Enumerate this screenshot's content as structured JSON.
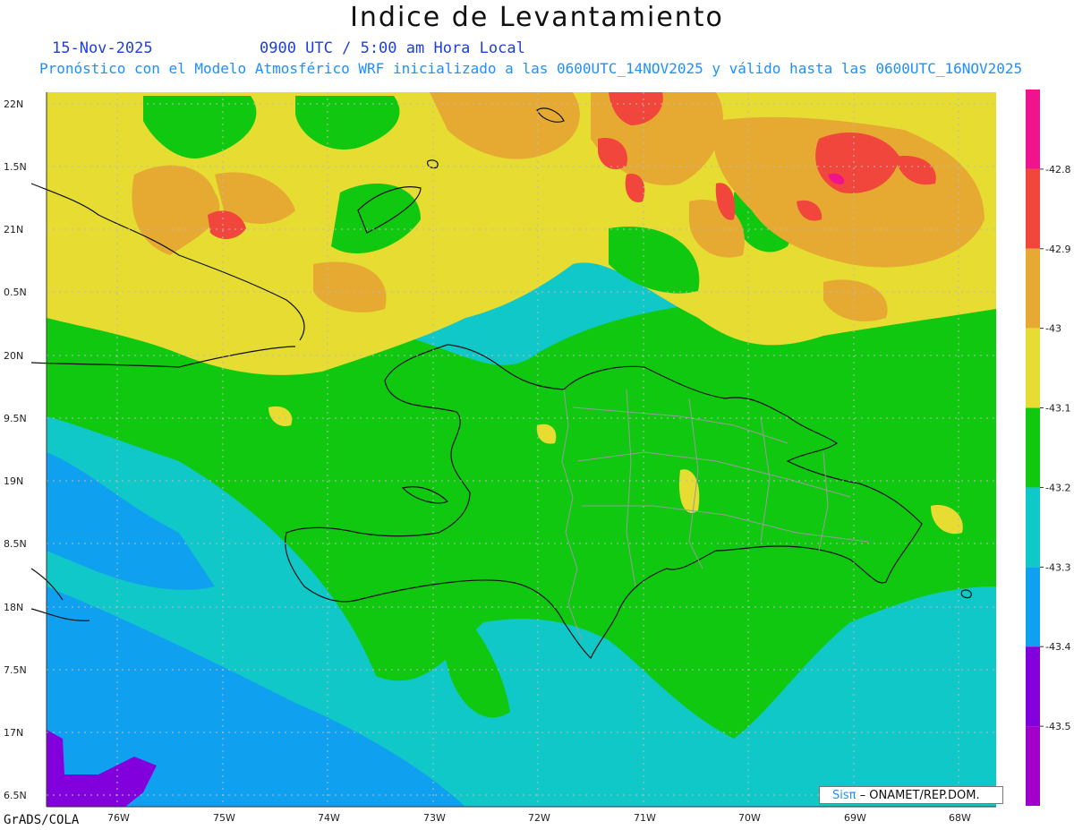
{
  "header": {
    "title": "Indice de Levantamiento",
    "date": "15-Nov-2025",
    "time": "0900 UTC / 5:00 am Hora Local",
    "subtitle": "Pronóstico con el Modelo Atmosférico WRF inicializado a las 0600UTC_14NOV2025 y válido hasta las  0600UTC_16NOV2025"
  },
  "axes": {
    "lat_labels": [
      "22N",
      "1.5N",
      "21N",
      "0.5N",
      "20N",
      "9.5N",
      "19N",
      "8.5N",
      "18N",
      "7.5N",
      "17N",
      "6.5N"
    ],
    "lon_labels": [
      "76W",
      "75W",
      "74W",
      "73W",
      "72W",
      "71W",
      "70W",
      "69W",
      "68W"
    ]
  },
  "legend": {
    "labels": [
      "-42.8",
      "-42.9",
      "-43",
      "-43.1",
      "-43.2",
      "-43.3",
      "-43.4",
      "-43.5"
    ],
    "colors": [
      "#f0148c",
      "#f0463c",
      "#e6aa32",
      "#e6dc32",
      "#10c810",
      "#10c8c8",
      "#10a0f0",
      "#8200dc",
      "#a000c8"
    ]
  },
  "footer": {
    "credit": "GrADS/COLA",
    "badge_brand": "Sisπ",
    "badge_text": " – ONAMET/REP.DOM."
  }
}
